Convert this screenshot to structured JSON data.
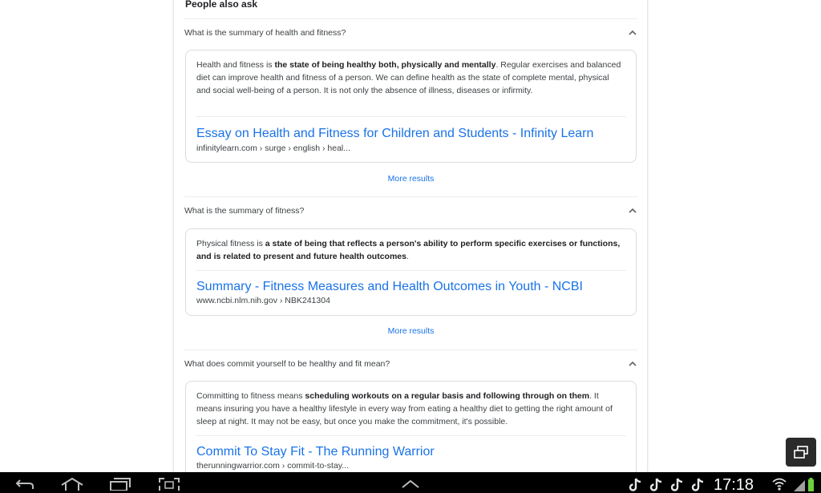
{
  "paa": {
    "title": "People also ask",
    "items": [
      {
        "question": "What is the summary of health and fitness?",
        "answer_pre": "Health and fitness is ",
        "answer_bold": "the state of being healthy both, physically and mentally",
        "answer_post": ". Regular exercises and balanced diet can improve health and fitness of a person. We can define health as the state of complete mental, physical and social well-being of a person. It is not only the absence of illness, diseases or infirmity.",
        "source_title": "Essay on Health and Fitness for Children and Students - Infinity Learn",
        "source_url": "infinitylearn.com › surge › english › heal...",
        "more": "More results"
      },
      {
        "question": "What is the summary of fitness?",
        "answer_pre": "Physical fitness is ",
        "answer_bold": "a state of being that reflects a person's ability to perform specific exercises or functions, and is related to present and future health outcomes",
        "answer_post": ".",
        "source_title": "Summary - Fitness Measures and Health Outcomes in Youth - NCBI",
        "source_url": "www.ncbi.nlm.nih.gov › NBK241304",
        "more": "More results"
      },
      {
        "question": "What does commit yourself to be healthy and fit mean?",
        "answer_pre": "Committing to fitness means ",
        "answer_bold": "scheduling workouts on a regular basis and following through on them",
        "answer_post": ". It means insuring you have a healthy lifestyle in every way from eating a healthy diet to getting the right amount of sleep at night. It may not be easy, but once you make the commitment, it's possible.",
        "source_title": "Commit To Stay Fit - The Running Warrior",
        "source_url": "therunningwarrior.com › commit-to-stay..."
      }
    ]
  },
  "system": {
    "time": "17:18",
    "nav_icons": [
      "back-icon",
      "home-icon",
      "recent-apps-icon",
      "screenshot-icon",
      "chevron-up-icon"
    ],
    "notification_icons": [
      "tiktok-icon",
      "tiktok-icon",
      "tiktok-icon",
      "tiktok-icon"
    ],
    "status_icons": [
      "wifi-icon",
      "signal-icon"
    ]
  },
  "colors": {
    "link": "#1a73e8",
    "text": "#3c4043",
    "navbar": "#000000"
  }
}
